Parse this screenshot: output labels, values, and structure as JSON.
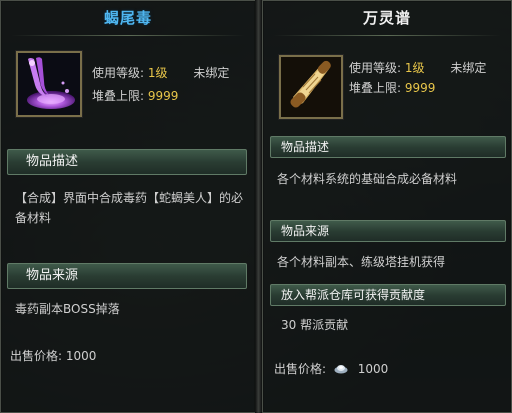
{
  "left": {
    "title": "蝎尾毒",
    "use_level_label": "使用等级:",
    "use_level_value": "1级",
    "bind_status": "未绑定",
    "stack_label": "堆叠上限:",
    "stack_value": "9999",
    "desc_header": "物品描述",
    "desc_line1": "【合成】界面中合成毒药【蛇蝎美人】的必",
    "desc_line2": "备材料",
    "source_header": "物品来源",
    "source_text": "毒药副本BOSS掉落",
    "price_label": "出售价格:",
    "price_value": "1000",
    "icon": "purple-poison-icon"
  },
  "right": {
    "title": "万灵谱",
    "use_level_label": "使用等级:",
    "use_level_value": "1级",
    "bind_status": "未绑定",
    "stack_label": "堆叠上限:",
    "stack_value": "9999",
    "desc_header": "物品描述",
    "desc_text": "各个材料系统的基础合成必备材料",
    "source_header": "物品来源",
    "source_text": "各个材料副本、练级塔挂机获得",
    "contrib_header": "放入帮派仓库可获得贡献度",
    "contrib_text": "30 帮派贡献",
    "price_label": "出售价格:",
    "price_value": "1000",
    "icon": "scroll-icon",
    "currency_icon": "silver-ingot-icon"
  },
  "colors": {
    "title_blue": "#4fb6f0",
    "value_gold": "#e8c64a",
    "section_green": "#2a3d33"
  }
}
